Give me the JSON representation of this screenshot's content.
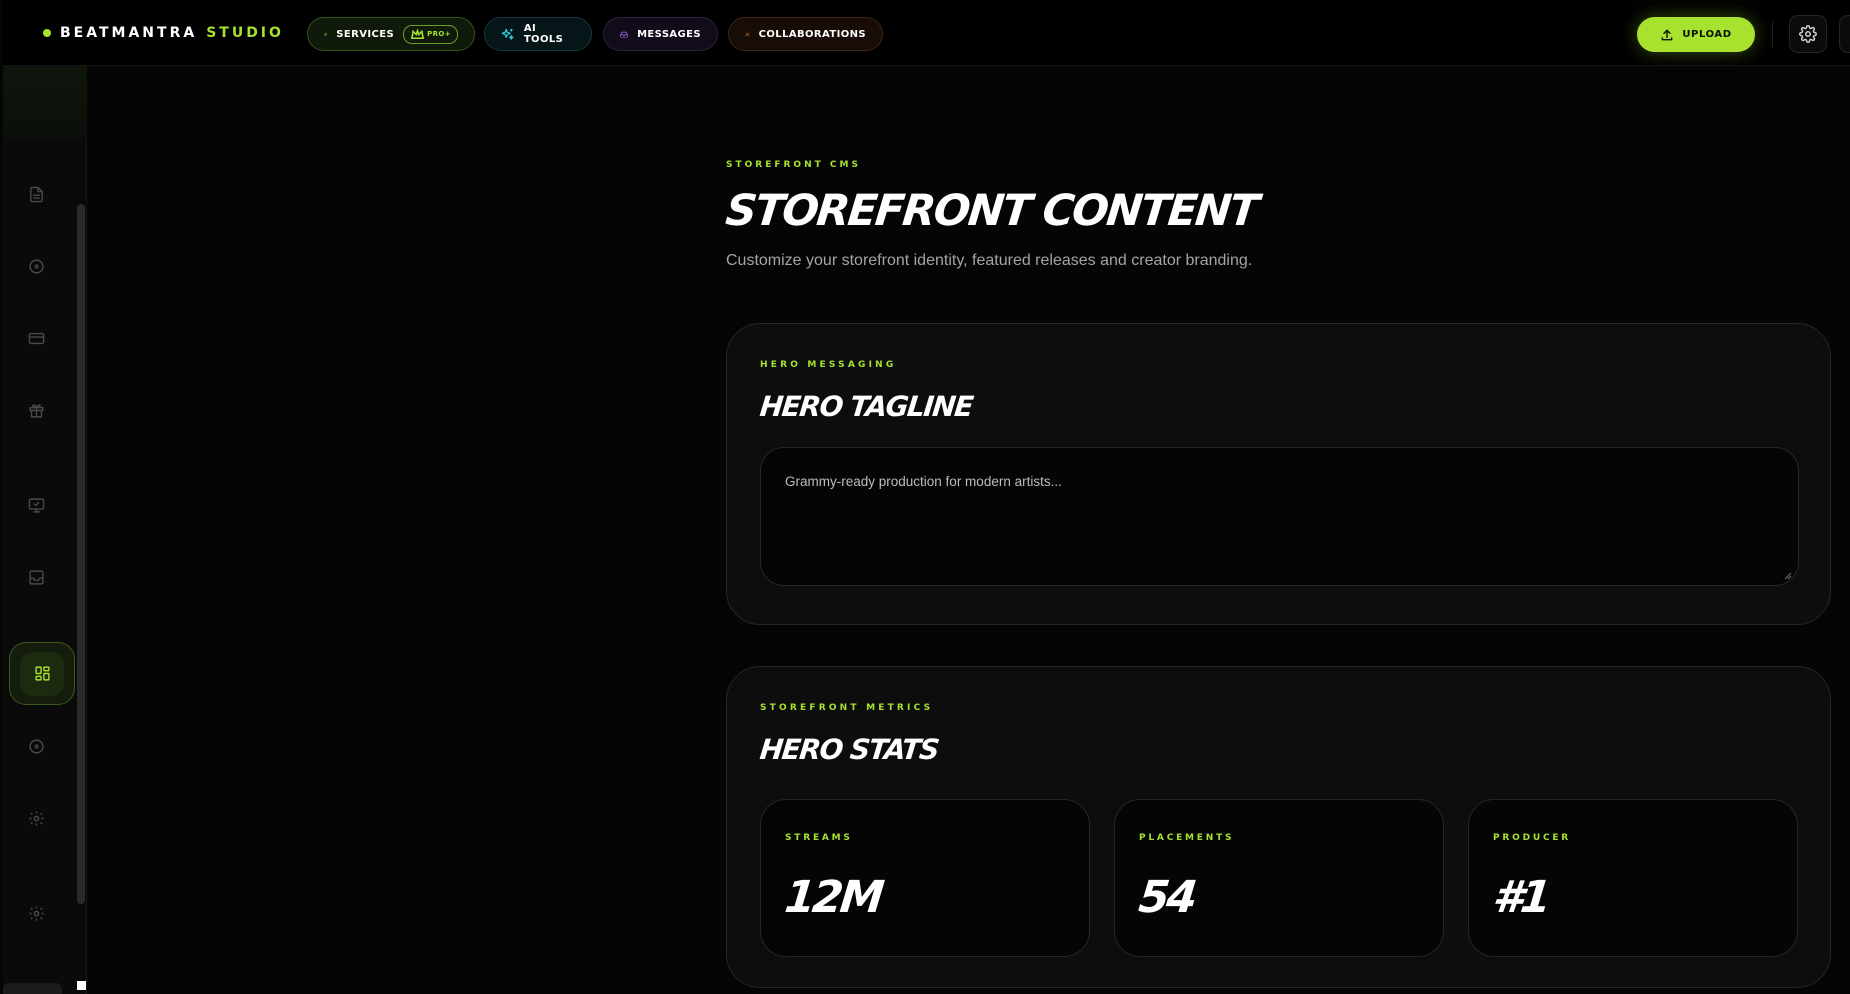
{
  "brand": {
    "name": "BEATMANTRA",
    "accent": "STUDIO",
    "accent_color": "#a6e22e"
  },
  "nav": {
    "services": {
      "label": "SERVICES",
      "badge": "PRO+",
      "icon": "package-icon"
    },
    "ai_tools": {
      "label": "AI TOOLS",
      "icon": "sparkles-icon"
    },
    "messages": {
      "label": "MESSAGES",
      "icon": "inbox-icon"
    },
    "collaborations": {
      "label": "COLLABORATIONS",
      "icon": "users-icon"
    }
  },
  "actions": {
    "upload_label": "UPLOAD",
    "settings_icon": "gear-icon"
  },
  "sidebar": {
    "items": [
      {
        "icon": "document-icon"
      },
      {
        "icon": "disc-icon"
      },
      {
        "icon": "card-icon"
      },
      {
        "icon": "gift-icon"
      },
      {
        "icon": "monitor-icon"
      },
      {
        "icon": "inbox-icon"
      },
      {
        "icon": "layout-grid-icon",
        "active": true
      },
      {
        "icon": "disc-icon"
      },
      {
        "icon": "gear-icon"
      },
      {
        "icon": "gear-icon"
      }
    ]
  },
  "page": {
    "eyebrow": "STOREFRONT CMS",
    "title": "STOREFRONT CONTENT",
    "subtitle": "Customize your storefront identity, featured releases and creator branding."
  },
  "hero": {
    "eyebrow": "HERO MESSAGING",
    "title": "HERO TAGLINE",
    "placeholder": "Grammy-ready production for modern artists..."
  },
  "stats": {
    "eyebrow": "STOREFRONT METRICS",
    "title": "HERO STATS",
    "items": [
      {
        "label": "STREAMS",
        "value": "12M"
      },
      {
        "label": "PLACEMENTS",
        "value": "54"
      },
      {
        "label": "PRODUCER",
        "value": "#1"
      }
    ]
  }
}
